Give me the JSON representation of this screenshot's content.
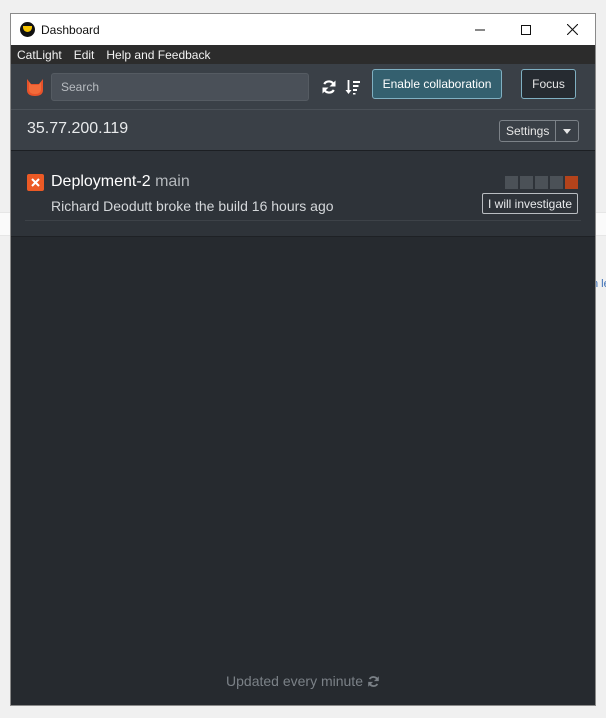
{
  "window": {
    "title": "Dashboard",
    "controls": [
      "minimize",
      "maximize",
      "close"
    ]
  },
  "menu": {
    "items": [
      "CatLight",
      "Edit",
      "Help and Feedback"
    ]
  },
  "toolbar": {
    "search_placeholder": "Search",
    "collaboration_label": "Enable collaboration",
    "focus_label": "Focus"
  },
  "server": {
    "name": "35.77.200.119",
    "settings_label": "Settings"
  },
  "build": {
    "status": "failed",
    "name": "Deployment-2",
    "branch": "main",
    "message": "Richard Deodutt broke the build 16 hours ago",
    "investigate_label": "I will investigate",
    "history": [
      "none",
      "none",
      "none",
      "none",
      "failed"
    ]
  },
  "footer": {
    "text": "Updated every minute"
  },
  "colors": {
    "accent": "#34606f",
    "failure": "#ec5a25",
    "background": "#262a2f",
    "toolbar": "#3a4047"
  }
}
